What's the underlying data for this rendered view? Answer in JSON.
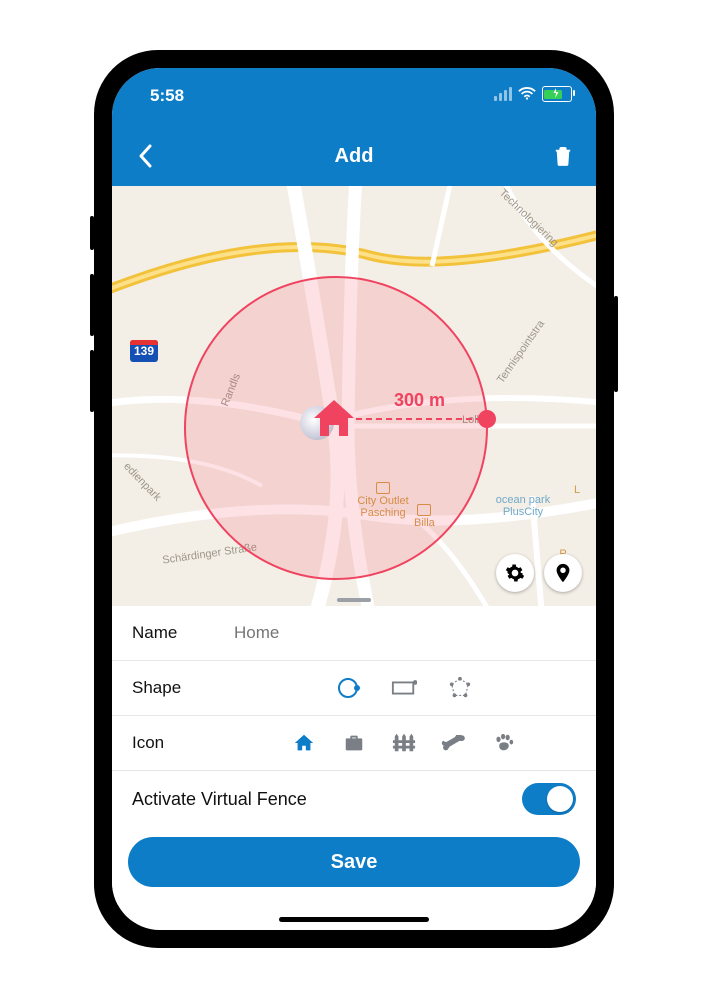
{
  "status": {
    "time": "5:58",
    "battery_pct": 70
  },
  "nav": {
    "title": "Add",
    "back_icon": "chevron-left",
    "delete_icon": "trash"
  },
  "map": {
    "route_shield": "139",
    "radius_label": "300 m",
    "street_labels": [
      "Randls",
      "Loll-R",
      "Tennispointstra",
      "Technologiering",
      "edienpark",
      "Schärdinger Straße"
    ],
    "pois": [
      {
        "name": "City Outlet Pasching"
      },
      {
        "name": "Billa"
      },
      {
        "name": "ocean park PlusCity"
      },
      {
        "name": "P\nInter"
      },
      {
        "name": "L"
      }
    ],
    "center_icon": "home"
  },
  "form": {
    "name_label": "Name",
    "name_placeholder": "Home",
    "name_value": "",
    "shape_label": "Shape",
    "shapes": [
      "circle",
      "rectangle",
      "polygon"
    ],
    "shape_selected": "circle",
    "icon_label": "Icon",
    "icons": [
      "home",
      "briefcase",
      "fence",
      "bone",
      "paw"
    ],
    "icon_selected": "home",
    "toggle_label": "Activate Virtual Fence",
    "toggle_on": true,
    "save_label": "Save"
  },
  "colors": {
    "accent": "#0E7DC7",
    "fence": "#F0435F"
  }
}
